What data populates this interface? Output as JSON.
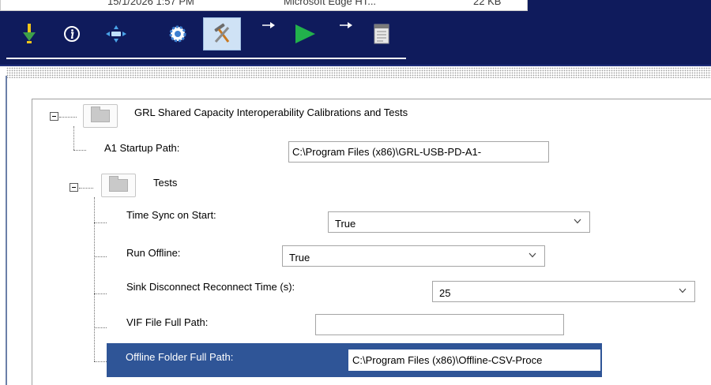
{
  "file_row": {
    "date": "15/1/2026 1:57 PM",
    "type": "Microsoft Edge HT...",
    "size": "22 KB"
  },
  "toolbar": {
    "icons": [
      "download-icon",
      "info-icon",
      "move-icon",
      "settings-gear-icon",
      "tools-icon",
      "arrow-right-icon",
      "play-icon",
      "arrow-right-icon",
      "document-icon"
    ],
    "selected": "tools-icon"
  },
  "tree": {
    "root_label": "GRL Shared Capacity Interoperability Calibrations and Tests",
    "a1_startup_path": {
      "label": "A1 Startup Path:",
      "value": "C:\\Program Files (x86)\\GRL-USB-PD-A1-"
    },
    "tests": {
      "label": "Tests",
      "time_sync": {
        "label": "Time Sync on Start:",
        "value": "True"
      },
      "run_offline": {
        "label": "Run Offline:",
        "value": "True"
      },
      "sink_disconnect": {
        "label": "Sink Disconnect Reconnect Time (s):",
        "value": "25"
      },
      "vif_file": {
        "label": "VIF File Full Path:",
        "value": ""
      },
      "offline_folder": {
        "label": "Offline Folder Full Path:",
        "value": "C:\\Program Files (x86)\\Offline-CSV-Proce"
      }
    }
  },
  "colors": {
    "toolbar_bg": "#0f1b5c",
    "selection_bg": "#2f5597",
    "selected_tool_bg": "#cfe2f5",
    "play_green": "#22b14c"
  }
}
